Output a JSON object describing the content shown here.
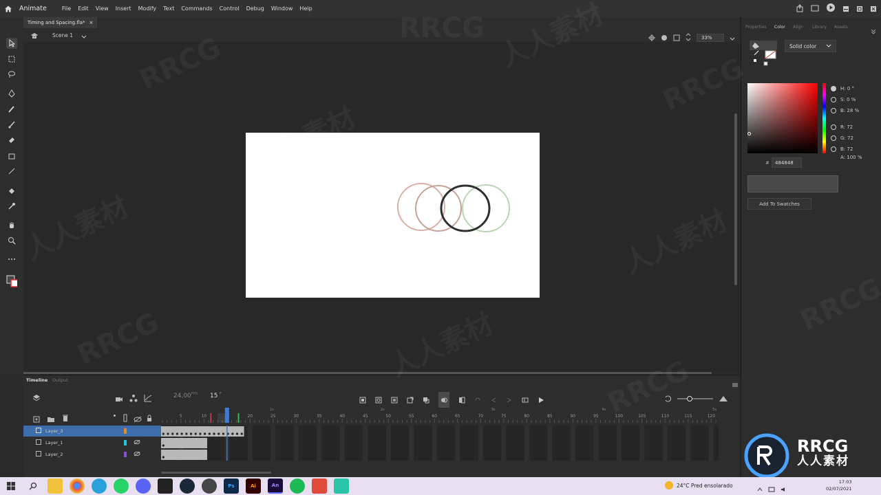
{
  "app": {
    "name": "Animate"
  },
  "menu": [
    "File",
    "Edit",
    "View",
    "Insert",
    "Modify",
    "Text",
    "Commands",
    "Control",
    "Debug",
    "Window",
    "Help"
  ],
  "document": {
    "tab_title": "Timing and Spacing.fla*",
    "close": "×",
    "scene": "Scene 1",
    "zoom": "33%"
  },
  "panel": {
    "tabs": [
      "Properties",
      "Color",
      "Align",
      "Library",
      "Assets"
    ],
    "active_tab": "Color",
    "fill_type": "Solid color",
    "hsb": {
      "h": "H: 0 °",
      "s": "S: 0 %",
      "b": "B: 28 %"
    },
    "rgb": {
      "r": "R: 72",
      "g": "G: 72",
      "b": "B: 72"
    },
    "alpha": "A: 100 %",
    "hash": "#",
    "hex": "484848",
    "add_swatches": "Add To Swatches"
  },
  "timeline": {
    "tabs": [
      "Timeline",
      "Output"
    ],
    "fps": "24,00",
    "fps_unit": "FPS",
    "current_frame": "15",
    "frame_unit": "F",
    "ruler": [
      "5",
      "10",
      "15",
      "20",
      "25",
      "30",
      "35",
      "40",
      "45",
      "50",
      "55",
      "60",
      "65",
      "70",
      "75",
      "80",
      "85",
      "90",
      "95",
      "100",
      "105",
      "110",
      "115",
      "120"
    ],
    "seconds": [
      "1s",
      "2s",
      "3s",
      "4s",
      "5s"
    ],
    "layers": [
      {
        "name": "Layer_3",
        "color": "#e08a2a",
        "selected": true
      },
      {
        "name": "Layer_1",
        "color": "#22c7d8",
        "selected": false
      },
      {
        "name": "Layer_2",
        "color": "#8a4fd8",
        "selected": false
      }
    ]
  },
  "taskbar": {
    "weather": "24°C  Pred ensolarado",
    "time": "17:03",
    "date": "02/07/2021"
  },
  "watermark": {
    "text1": "RRCG",
    "text2": "人人素材",
    "logo_text": "RRCG",
    "logo_sub": "人人素材"
  }
}
